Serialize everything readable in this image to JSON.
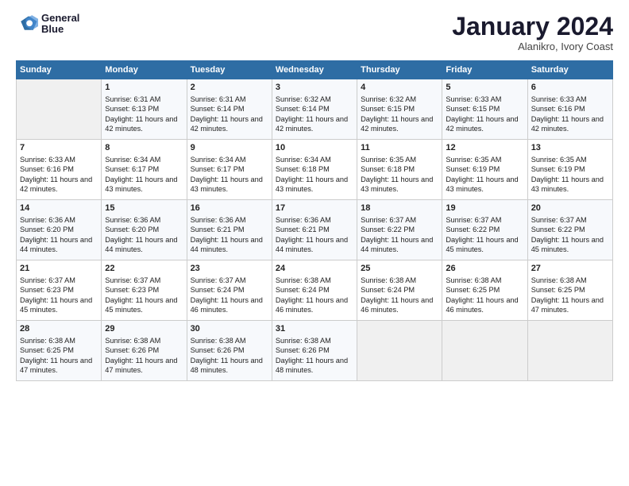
{
  "logo": {
    "line1": "General",
    "line2": "Blue"
  },
  "title": "January 2024",
  "subtitle": "Alanikro, Ivory Coast",
  "days_header": [
    "Sunday",
    "Monday",
    "Tuesday",
    "Wednesday",
    "Thursday",
    "Friday",
    "Saturday"
  ],
  "weeks": [
    [
      {
        "day": "",
        "content": ""
      },
      {
        "day": "1",
        "sr": "Sunrise: 6:31 AM",
        "ss": "Sunset: 6:13 PM",
        "dl": "Daylight: 11 hours and 42 minutes."
      },
      {
        "day": "2",
        "sr": "Sunrise: 6:31 AM",
        "ss": "Sunset: 6:14 PM",
        "dl": "Daylight: 11 hours and 42 minutes."
      },
      {
        "day": "3",
        "sr": "Sunrise: 6:32 AM",
        "ss": "Sunset: 6:14 PM",
        "dl": "Daylight: 11 hours and 42 minutes."
      },
      {
        "day": "4",
        "sr": "Sunrise: 6:32 AM",
        "ss": "Sunset: 6:15 PM",
        "dl": "Daylight: 11 hours and 42 minutes."
      },
      {
        "day": "5",
        "sr": "Sunrise: 6:33 AM",
        "ss": "Sunset: 6:15 PM",
        "dl": "Daylight: 11 hours and 42 minutes."
      },
      {
        "day": "6",
        "sr": "Sunrise: 6:33 AM",
        "ss": "Sunset: 6:16 PM",
        "dl": "Daylight: 11 hours and 42 minutes."
      }
    ],
    [
      {
        "day": "7",
        "sr": "Sunrise: 6:33 AM",
        "ss": "Sunset: 6:16 PM",
        "dl": "Daylight: 11 hours and 42 minutes."
      },
      {
        "day": "8",
        "sr": "Sunrise: 6:34 AM",
        "ss": "Sunset: 6:17 PM",
        "dl": "Daylight: 11 hours and 43 minutes."
      },
      {
        "day": "9",
        "sr": "Sunrise: 6:34 AM",
        "ss": "Sunset: 6:17 PM",
        "dl": "Daylight: 11 hours and 43 minutes."
      },
      {
        "day": "10",
        "sr": "Sunrise: 6:34 AM",
        "ss": "Sunset: 6:18 PM",
        "dl": "Daylight: 11 hours and 43 minutes."
      },
      {
        "day": "11",
        "sr": "Sunrise: 6:35 AM",
        "ss": "Sunset: 6:18 PM",
        "dl": "Daylight: 11 hours and 43 minutes."
      },
      {
        "day": "12",
        "sr": "Sunrise: 6:35 AM",
        "ss": "Sunset: 6:19 PM",
        "dl": "Daylight: 11 hours and 43 minutes."
      },
      {
        "day": "13",
        "sr": "Sunrise: 6:35 AM",
        "ss": "Sunset: 6:19 PM",
        "dl": "Daylight: 11 hours and 43 minutes."
      }
    ],
    [
      {
        "day": "14",
        "sr": "Sunrise: 6:36 AM",
        "ss": "Sunset: 6:20 PM",
        "dl": "Daylight: 11 hours and 44 minutes."
      },
      {
        "day": "15",
        "sr": "Sunrise: 6:36 AM",
        "ss": "Sunset: 6:20 PM",
        "dl": "Daylight: 11 hours and 44 minutes."
      },
      {
        "day": "16",
        "sr": "Sunrise: 6:36 AM",
        "ss": "Sunset: 6:21 PM",
        "dl": "Daylight: 11 hours and 44 minutes."
      },
      {
        "day": "17",
        "sr": "Sunrise: 6:36 AM",
        "ss": "Sunset: 6:21 PM",
        "dl": "Daylight: 11 hours and 44 minutes."
      },
      {
        "day": "18",
        "sr": "Sunrise: 6:37 AM",
        "ss": "Sunset: 6:22 PM",
        "dl": "Daylight: 11 hours and 44 minutes."
      },
      {
        "day": "19",
        "sr": "Sunrise: 6:37 AM",
        "ss": "Sunset: 6:22 PM",
        "dl": "Daylight: 11 hours and 45 minutes."
      },
      {
        "day": "20",
        "sr": "Sunrise: 6:37 AM",
        "ss": "Sunset: 6:22 PM",
        "dl": "Daylight: 11 hours and 45 minutes."
      }
    ],
    [
      {
        "day": "21",
        "sr": "Sunrise: 6:37 AM",
        "ss": "Sunset: 6:23 PM",
        "dl": "Daylight: 11 hours and 45 minutes."
      },
      {
        "day": "22",
        "sr": "Sunrise: 6:37 AM",
        "ss": "Sunset: 6:23 PM",
        "dl": "Daylight: 11 hours and 45 minutes."
      },
      {
        "day": "23",
        "sr": "Sunrise: 6:37 AM",
        "ss": "Sunset: 6:24 PM",
        "dl": "Daylight: 11 hours and 46 minutes."
      },
      {
        "day": "24",
        "sr": "Sunrise: 6:38 AM",
        "ss": "Sunset: 6:24 PM",
        "dl": "Daylight: 11 hours and 46 minutes."
      },
      {
        "day": "25",
        "sr": "Sunrise: 6:38 AM",
        "ss": "Sunset: 6:24 PM",
        "dl": "Daylight: 11 hours and 46 minutes."
      },
      {
        "day": "26",
        "sr": "Sunrise: 6:38 AM",
        "ss": "Sunset: 6:25 PM",
        "dl": "Daylight: 11 hours and 46 minutes."
      },
      {
        "day": "27",
        "sr": "Sunrise: 6:38 AM",
        "ss": "Sunset: 6:25 PM",
        "dl": "Daylight: 11 hours and 47 minutes."
      }
    ],
    [
      {
        "day": "28",
        "sr": "Sunrise: 6:38 AM",
        "ss": "Sunset: 6:25 PM",
        "dl": "Daylight: 11 hours and 47 minutes."
      },
      {
        "day": "29",
        "sr": "Sunrise: 6:38 AM",
        "ss": "Sunset: 6:26 PM",
        "dl": "Daylight: 11 hours and 47 minutes."
      },
      {
        "day": "30",
        "sr": "Sunrise: 6:38 AM",
        "ss": "Sunset: 6:26 PM",
        "dl": "Daylight: 11 hours and 48 minutes."
      },
      {
        "day": "31",
        "sr": "Sunrise: 6:38 AM",
        "ss": "Sunset: 6:26 PM",
        "dl": "Daylight: 11 hours and 48 minutes."
      },
      {
        "day": "",
        "content": ""
      },
      {
        "day": "",
        "content": ""
      },
      {
        "day": "",
        "content": ""
      }
    ]
  ]
}
